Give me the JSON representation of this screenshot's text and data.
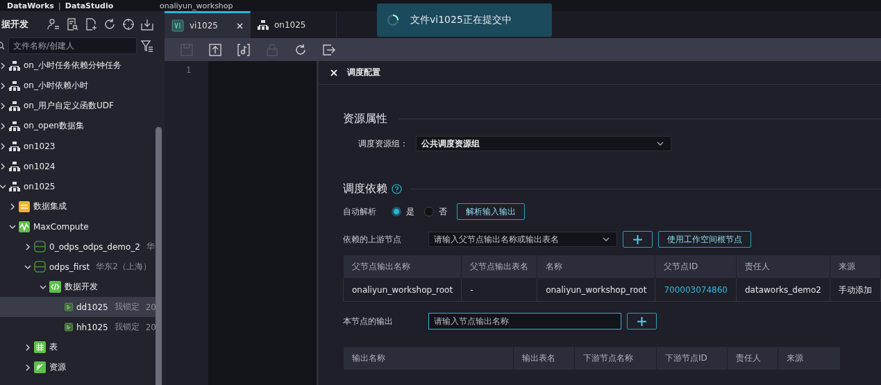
{
  "top_bar": {
    "product": "DataWorks",
    "separator": "|",
    "module": "DataStudio",
    "workspace": "onaliyun_workshop"
  },
  "sidebar": {
    "title": "据开发",
    "search": {
      "placeholder": "文件名称/创建人"
    },
    "tree": [
      {
        "label": "on_小时任务依赖分钟任务",
        "kind": "flow",
        "expanded": false,
        "selected": false
      },
      {
        "label": "on_小时依赖小时",
        "kind": "flow",
        "expanded": false,
        "selected": false
      },
      {
        "label": "on_用户自定义函数UDF",
        "kind": "flow",
        "expanded": false,
        "selected": false
      },
      {
        "label": "on_open数据集",
        "kind": "flow",
        "expanded": false,
        "selected": false
      },
      {
        "label": "on1023",
        "kind": "flow",
        "expanded": false,
        "selected": false
      },
      {
        "label": "on1024",
        "kind": "flow",
        "expanded": false,
        "selected": false
      },
      {
        "label": "on1025",
        "kind": "flow",
        "expanded": true,
        "selected": false,
        "children": [
          {
            "label": "数据集成",
            "kind": "integration",
            "expanded": false,
            "selected": false
          },
          {
            "label": "MaxCompute",
            "kind": "maxcompute",
            "expanded": true,
            "selected": false,
            "children": [
              {
                "label": "0_odps_odps_demo_2",
                "note": "华",
                "kind": "project",
                "expanded": false,
                "selected": false
              },
              {
                "label": "odps_first",
                "note": "华东2（上海）",
                "kind": "project",
                "expanded": true,
                "selected": false,
                "children": [
                  {
                    "label": "数据开发",
                    "kind": "dev",
                    "expanded": true,
                    "selected": false,
                    "children": [
                      {
                        "label": "dd1025",
                        "note": "我锁定",
                        "extra": "20",
                        "kind": "sql",
                        "selected": true
                      },
                      {
                        "label": "hh1025",
                        "note": "我锁定",
                        "extra": "20",
                        "kind": "sql",
                        "selected": false
                      }
                    ]
                  }
                ]
              },
              {
                "label": "表",
                "kind": "table",
                "expanded": false,
                "selected": false
              },
              {
                "label": "资源",
                "kind": "resource",
                "expanded": false,
                "selected": false
              }
            ]
          }
        ]
      }
    ]
  },
  "tabs": [
    {
      "label": "vi1025",
      "kind": "file",
      "selected": true,
      "closable": true
    },
    {
      "label": "on1025",
      "kind": "flow",
      "selected": false,
      "closable": false
    }
  ],
  "editor": {
    "line_numbers": [
      "1"
    ]
  },
  "toast": {
    "message": "文件vi1025正在提交中"
  },
  "panel": {
    "title": "调度配置",
    "resource": {
      "heading": "资源属性",
      "label": "调度资源组：",
      "value": "公共调度资源组"
    },
    "dependency": {
      "heading": "调度依赖",
      "auto_label": "自动解析",
      "options": [
        {
          "label": "是",
          "selected": true
        },
        {
          "label": "否",
          "selected": false
        }
      ],
      "parse_button": "解析输入输出",
      "upstream_label": "依赖的上游节点",
      "upstream_placeholder": "请输入父节点输出名称或输出表名",
      "root_button": "使用工作空间根节点",
      "parents": {
        "columns": [
          "父节点输出名称",
          "父节点输出表名",
          "名称",
          "父节点ID",
          "责任人",
          "来源"
        ],
        "rows": [
          [
            "onaliyun_workshop_root",
            "-",
            "onaliyun_workshop_root",
            "700003074860",
            "dataworks_demo2",
            "手动添加"
          ]
        ]
      },
      "output_label": "本节点的输出",
      "output_placeholder": "请输入节点输出名称",
      "outputs": {
        "columns": [
          "输出名称",
          "输出表名",
          "下游节点名称",
          "下游节点ID",
          "责任人",
          "来源"
        ]
      }
    }
  }
}
